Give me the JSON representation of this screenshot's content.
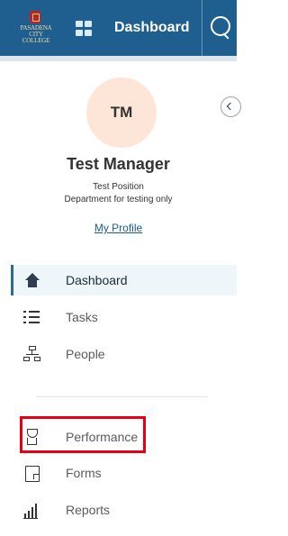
{
  "topbar": {
    "logo_text": "PASADENA\nCITY COLLEGE",
    "title": "Dashboard",
    "apps_icon": "grid-icon",
    "search_icon": "search-icon"
  },
  "profile": {
    "initials": "TM",
    "name": "Test Manager",
    "position": "Test Position",
    "department": "Department for testing only",
    "profile_link": "My Profile"
  },
  "sidebar": {
    "items": [
      {
        "label": "Dashboard",
        "icon": "home-icon",
        "active": true
      },
      {
        "label": "Tasks",
        "icon": "tasks-icon",
        "active": false
      },
      {
        "label": "People",
        "icon": "people-icon",
        "active": false
      },
      {
        "label": "Performance",
        "icon": "trophy-icon",
        "active": false
      },
      {
        "label": "Forms",
        "icon": "forms-icon",
        "active": false
      },
      {
        "label": "Reports",
        "icon": "reports-icon",
        "active": false
      }
    ]
  },
  "colors": {
    "topbar": "#1f5f8f",
    "active_bg": "#eef6fa",
    "active_border": "#2b6999",
    "highlight": "#e60012",
    "avatar_bg": "#fde6d7"
  }
}
